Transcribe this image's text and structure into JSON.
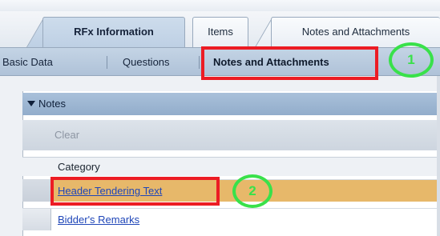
{
  "tabs": [
    {
      "label": "RFx Information",
      "active": true
    },
    {
      "label": "Items",
      "active": false
    },
    {
      "label": "Notes and Attachments",
      "active": false
    }
  ],
  "subtabs": [
    {
      "label": "Basic Data"
    },
    {
      "label": "Questions"
    },
    {
      "label": "Notes and Attachments",
      "active": true
    }
  ],
  "notes_panel": {
    "title": "Notes",
    "toolbar": {
      "clear_label": "Clear"
    },
    "column_header": "Category",
    "rows": [
      {
        "category": "Header Tendering Text",
        "selected": true
      },
      {
        "category": "Bidder's Remarks",
        "selected": false
      }
    ]
  },
  "annotations": {
    "step1": "1",
    "step2": "2",
    "box_color": "#ec1c24",
    "circle_color": "#39e14a"
  },
  "colors": {
    "active_tab": "#c6d7ea",
    "subtab_bar": "#b9cbe0",
    "panel_header": "#9db7d3",
    "selected_row": "#e7b86a",
    "link": "#1f46b8"
  }
}
